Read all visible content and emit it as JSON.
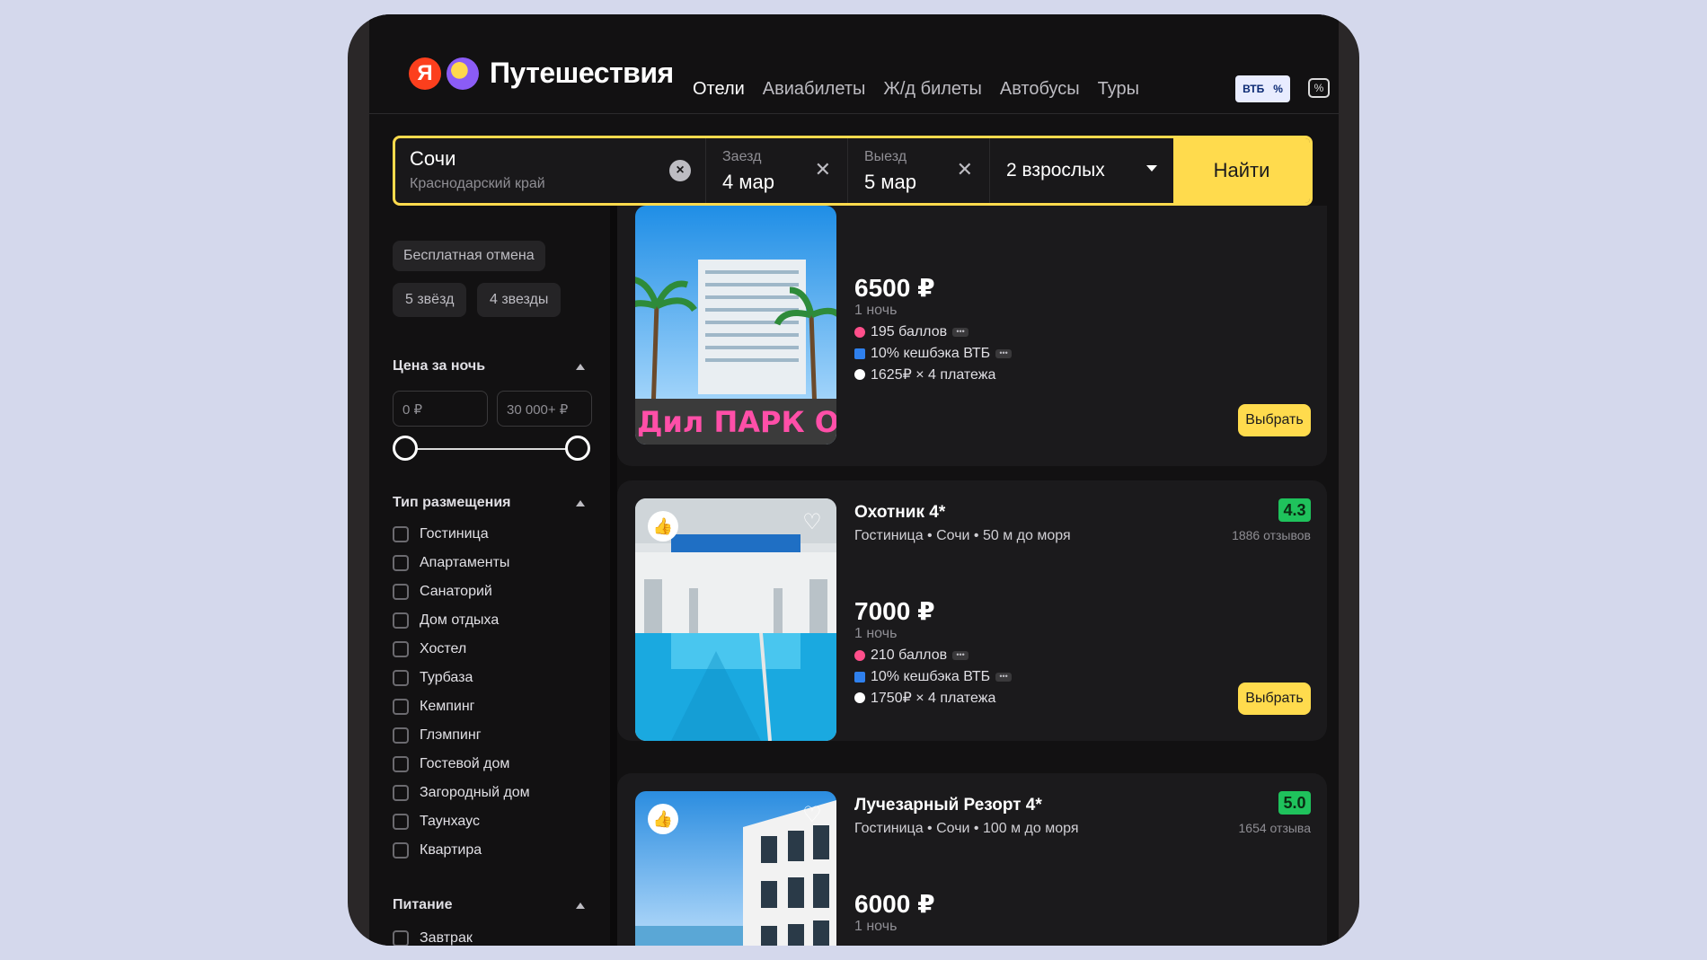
{
  "header": {
    "logo_letter": "Я",
    "logo_text": "Путешествия",
    "nav": [
      "Отели",
      "Авиабилеты",
      "Ж/д билеты",
      "Автобусы",
      "Туры"
    ],
    "vtb_label": "ВТБ",
    "vtb_suffix": "%"
  },
  "search": {
    "city": "Сочи",
    "region": "Краснодарский край",
    "checkin_label": "Заезд",
    "checkin_value": "4 мар",
    "checkout_label": "Выезд",
    "checkout_value": "5 мар",
    "guests": "2 взрослых",
    "find_label": "Найти"
  },
  "sidebar": {
    "chips": [
      "Бесплатная отмена",
      "5 звёзд",
      "4 звезды"
    ],
    "price_title": "Цена за ночь",
    "price_min_placeholder": "0 ₽",
    "price_max_placeholder": "30 000+ ₽",
    "type_title": "Тип размещения",
    "types": [
      "Гостиница",
      "Апартаменты",
      "Санаторий",
      "Дом отдыха",
      "Хостел",
      "Турбаза",
      "Кемпинг",
      "Глэмпинг",
      "Гостевой дом",
      "Загородный дом",
      "Таунхаус",
      "Квартира"
    ],
    "food_title": "Питание",
    "food": [
      "Завтрак"
    ]
  },
  "hotels": [
    {
      "name": "",
      "price": "6500 ₽",
      "per": "1 ночь",
      "points": "195 баллов",
      "cashback": "10% кешбэка ВТБ",
      "installments": "1625₽ × 4 платежа",
      "pick": "Выбрать",
      "photo_sign": "Дил ПАРК ОТЕ"
    },
    {
      "name": "Охотник 4*",
      "meta": "Гостиница • Сочи • 50 м до моря",
      "rating": "4.3",
      "reviews": "1886 отзывов",
      "price": "7000 ₽",
      "per": "1 ночь",
      "points": "210 баллов",
      "cashback": "10% кешбэка ВТБ",
      "installments": "1750₽ × 4 платежа",
      "pick": "Выбрать"
    },
    {
      "name": "Лучезарный Резорт 4*",
      "meta": "Гостиница • Сочи • 100 м до моря",
      "rating": "5.0",
      "reviews": "1654 отзыва",
      "price": "6000 ₽",
      "per": "1 ночь"
    }
  ],
  "colors": {
    "accent": "#ffdb4d",
    "rating_green": "#1fc25c",
    "bg": "#121112",
    "card": "#1b1a1c"
  }
}
